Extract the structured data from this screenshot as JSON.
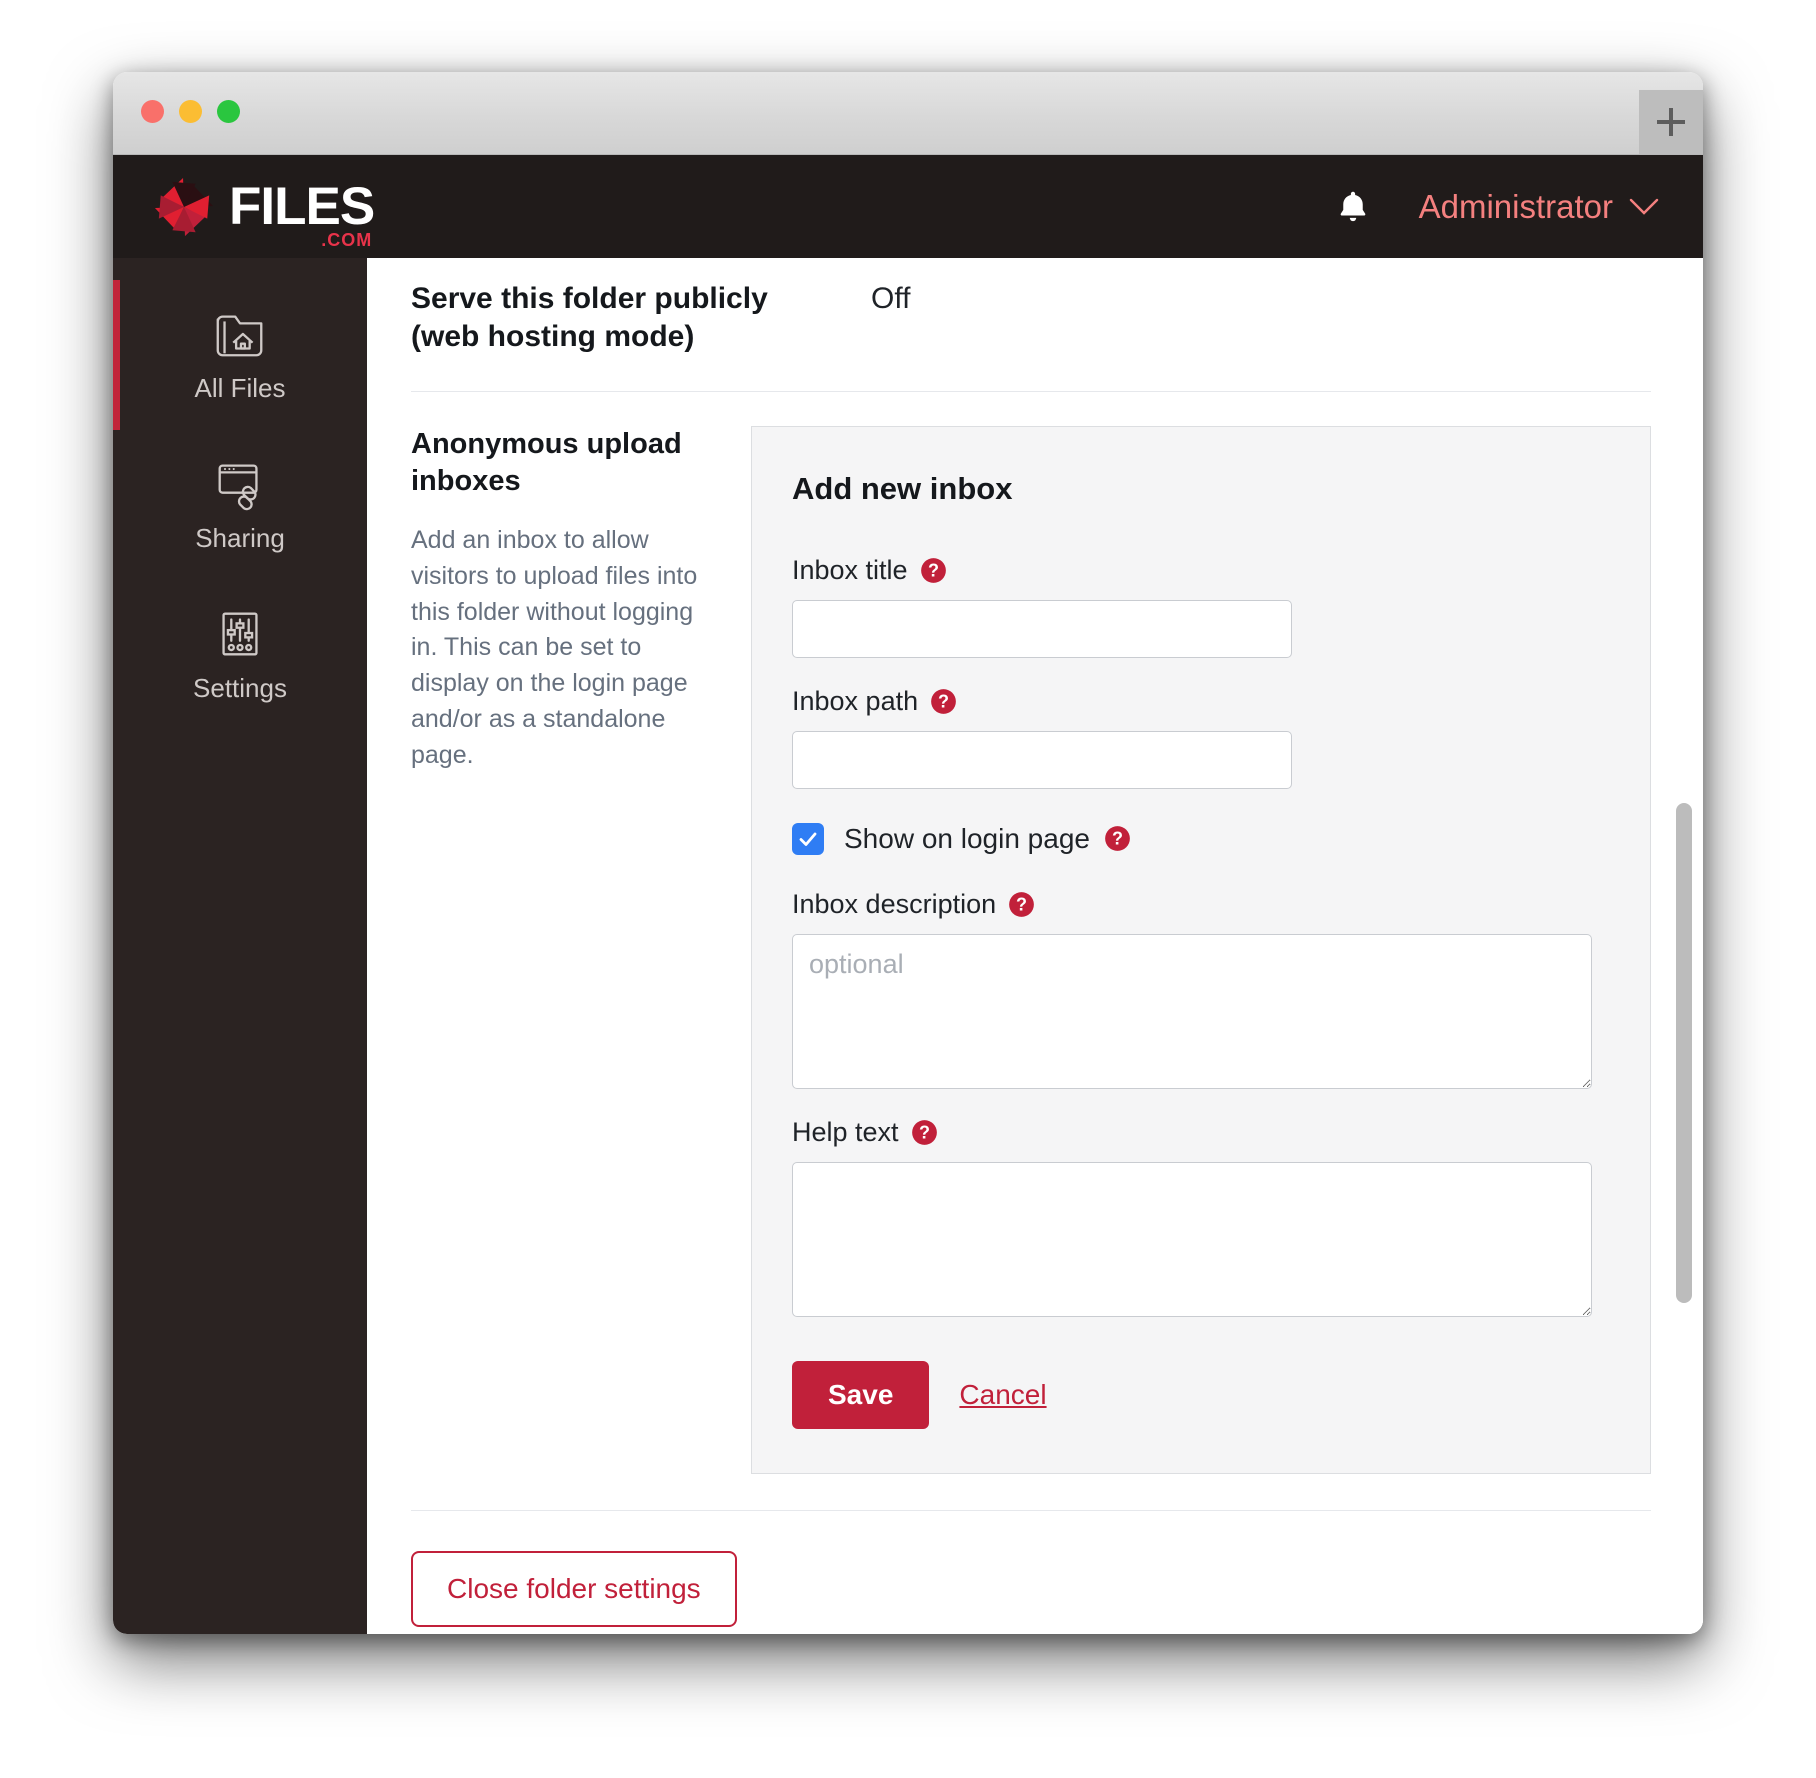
{
  "window": {
    "traffic_lights": [
      "close",
      "minimize",
      "zoom"
    ],
    "new_tab_label": "+"
  },
  "header": {
    "logo_text": "FILES",
    "logo_suffix": ".COM",
    "notifications_icon": "bell-icon",
    "account_label": "Administrator",
    "account_chevron": "chevron-down-icon",
    "accent_color": "#c1203a",
    "account_text_color": "#f4807f",
    "background_color": "#201b1a"
  },
  "sidebar": {
    "background_color": "#2b2322",
    "active_indicator_color": "#c1243a",
    "items": [
      {
        "label": "All Files",
        "icon": "folder-home-icon",
        "active": true
      },
      {
        "label": "Sharing",
        "icon": "browser-link-icon",
        "active": false
      },
      {
        "label": "Settings",
        "icon": "sliders-icon",
        "active": false
      }
    ]
  },
  "main": {
    "top_setting": {
      "label": "Serve this folder publicly (web hosting mode)",
      "value": "Off"
    },
    "section": {
      "title": "Anonymous upload inboxes",
      "description": "Add an inbox to allow visitors to upload files into this folder without logging in. This can be set to display on the login page and/or as a standalone page."
    },
    "card": {
      "title": "Add new inbox",
      "fields": [
        {
          "label": "Inbox title",
          "help_icon": "help-circle-icon",
          "value": "",
          "placeholder": ""
        },
        {
          "label": "Inbox path",
          "help_icon": "help-circle-icon",
          "value": "",
          "placeholder": ""
        }
      ],
      "checkbox": {
        "label": "Show on login page",
        "checked": true,
        "help_icon": "help-circle-icon",
        "color": "#2f7df4"
      },
      "description_field": {
        "label": "Inbox description",
        "help_icon": "help-circle-icon",
        "value": "",
        "placeholder": "optional"
      },
      "help_text_field": {
        "label": "Help text",
        "help_icon": "help-circle-icon",
        "value": "",
        "placeholder": ""
      },
      "save_label": "Save",
      "cancel_label": "Cancel"
    },
    "close_settings_label": "Close folder settings"
  }
}
